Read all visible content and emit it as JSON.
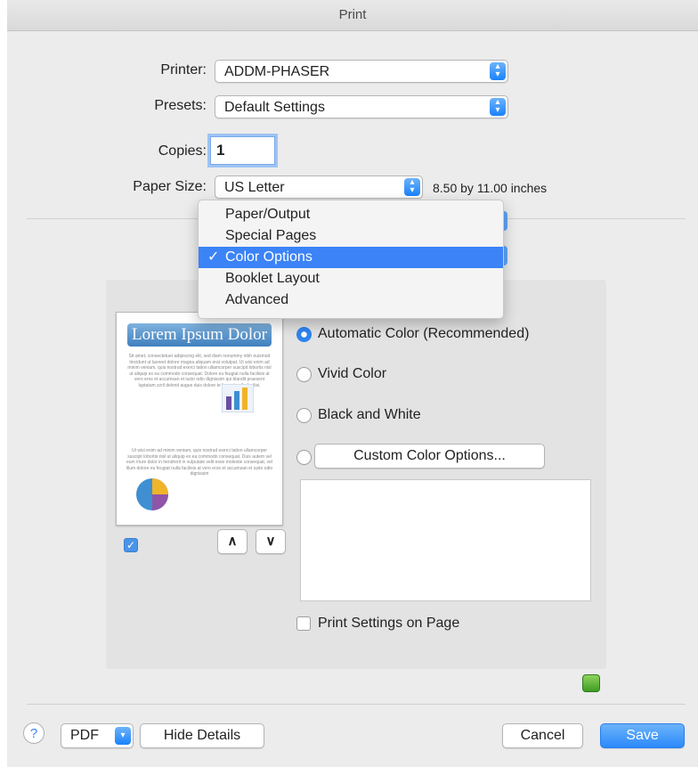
{
  "window": {
    "title": "Print"
  },
  "form": {
    "printer_label": "Printer:",
    "printer_value": "ADDM-PHASER",
    "presets_label": "Presets:",
    "presets_value": "Default Settings",
    "copies_label": "Copies:",
    "copies_value": "1",
    "paper_size_label": "Paper Size:",
    "paper_size_value": "US Letter",
    "paper_size_dims": "8.50 by 11.00 inches"
  },
  "menu": {
    "items": [
      "Paper/Output",
      "Special Pages",
      "Color Options",
      "Booklet Layout",
      "Advanced"
    ],
    "selected": "Color Options",
    "check_glyph": "✓"
  },
  "preview": {
    "title": "Lorem Ipsum Dolor",
    "para1": "Sit amet, consectetuer adipiscing elit, sed diam nonummy nibh euismod tincidunt ut laoreet dolore magna aliquam erat volutpat. Ut wisi enim ad minim veniam, quis nostrud exerci tation ullamcorper suscipit lobortis nisl ut aliquip ex ea commodo consequat. Dolore eu feugiat nulla facilisis at vero eros et accumsan et iusto odio dignissim qui blandit praesent luptatum zzril delenit augue duis dolore te feugait nulla facilisi.",
    "para2": "Ut wisi enim ad minim veniam, quis nostrud exerci tation ullamcorper suscipit lobortis nisl ut aliquip ex ea commodo consequat. Duis autem vel eum iriure dolor in hendrerit in vulputate velit esse molestie consequat, vel illum dolore eu feugiat nulla facilisis at vero eros et accumsan et iusto odio dignissim",
    "show_quick_preview_checked": true,
    "page_up_glyph": "∧",
    "page_down_glyph": "∨"
  },
  "color_options": {
    "automatic": "Automatic Color (Recommended)",
    "vivid": "Vivid Color",
    "bw": "Black and White",
    "custom_button": "Custom Color Options...",
    "selected": "automatic",
    "print_settings_on_page": "Print Settings on Page",
    "print_settings_checked": false
  },
  "footer": {
    "help_glyph": "?",
    "pdf_label": "PDF",
    "hide_details": "Hide Details",
    "cancel": "Cancel",
    "save": "Save"
  },
  "colors": {
    "accent": "#3b83f7",
    "panel": "#e3e3e3",
    "window": "#ececec"
  }
}
